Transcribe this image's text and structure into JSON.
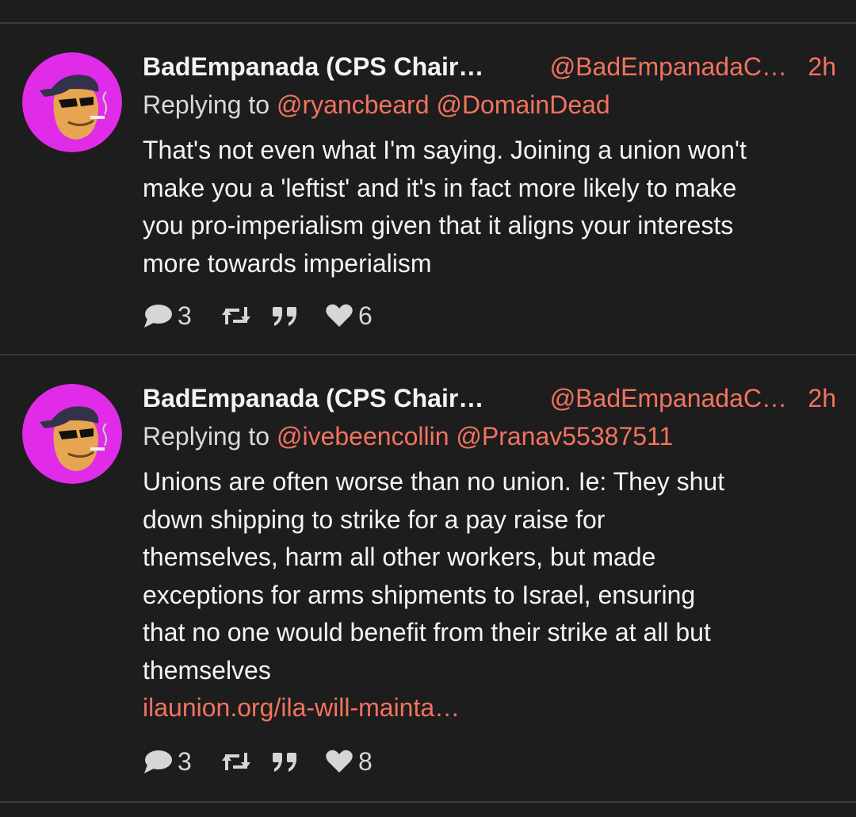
{
  "posts": [
    {
      "display_name": "BadEmpanada (CPS Chair…",
      "handle": "@BadEmpanadaC…",
      "time": "2h",
      "reply_prefix": "Replying to",
      "mentions": [
        "@ryancbeard",
        "@DomainDead"
      ],
      "lines": [
        "That's not even what I'm saying. Joining a union won't",
        "make you a 'leftist' and it's in fact more likely to make",
        "you pro-imperialism given that it aligns your interests",
        "more towards imperialism"
      ],
      "link": "",
      "replies_count": "3",
      "likes_count": "6"
    },
    {
      "display_name": "BadEmpanada (CPS Chair…",
      "handle": "@BadEmpanadaC…",
      "time": "2h",
      "reply_prefix": "Replying to",
      "mentions": [
        "@ivebeencollin",
        "@Pranav55387511"
      ],
      "lines": [
        "Unions are often worse than no union. Ie: They shut",
        "down shipping to strike for a pay raise for",
        "themselves, harm all other workers, but made",
        "exceptions for arms shipments to Israel, ensuring",
        "that no one would benefit from their strike at all but",
        "themselves"
      ],
      "link": "ilaunion.org/ila-will-mainta…",
      "replies_count": "3",
      "likes_count": "8"
    }
  ],
  "icons": {
    "reply": "speech-bubble-icon",
    "retweet": "retweet-icon",
    "quote": "quote-icon",
    "like": "heart-icon"
  },
  "colors": {
    "background": "#1d1d1d",
    "accent": "#f2735f",
    "divider": "#3b3b3b",
    "avatar": "#e02ce8"
  }
}
